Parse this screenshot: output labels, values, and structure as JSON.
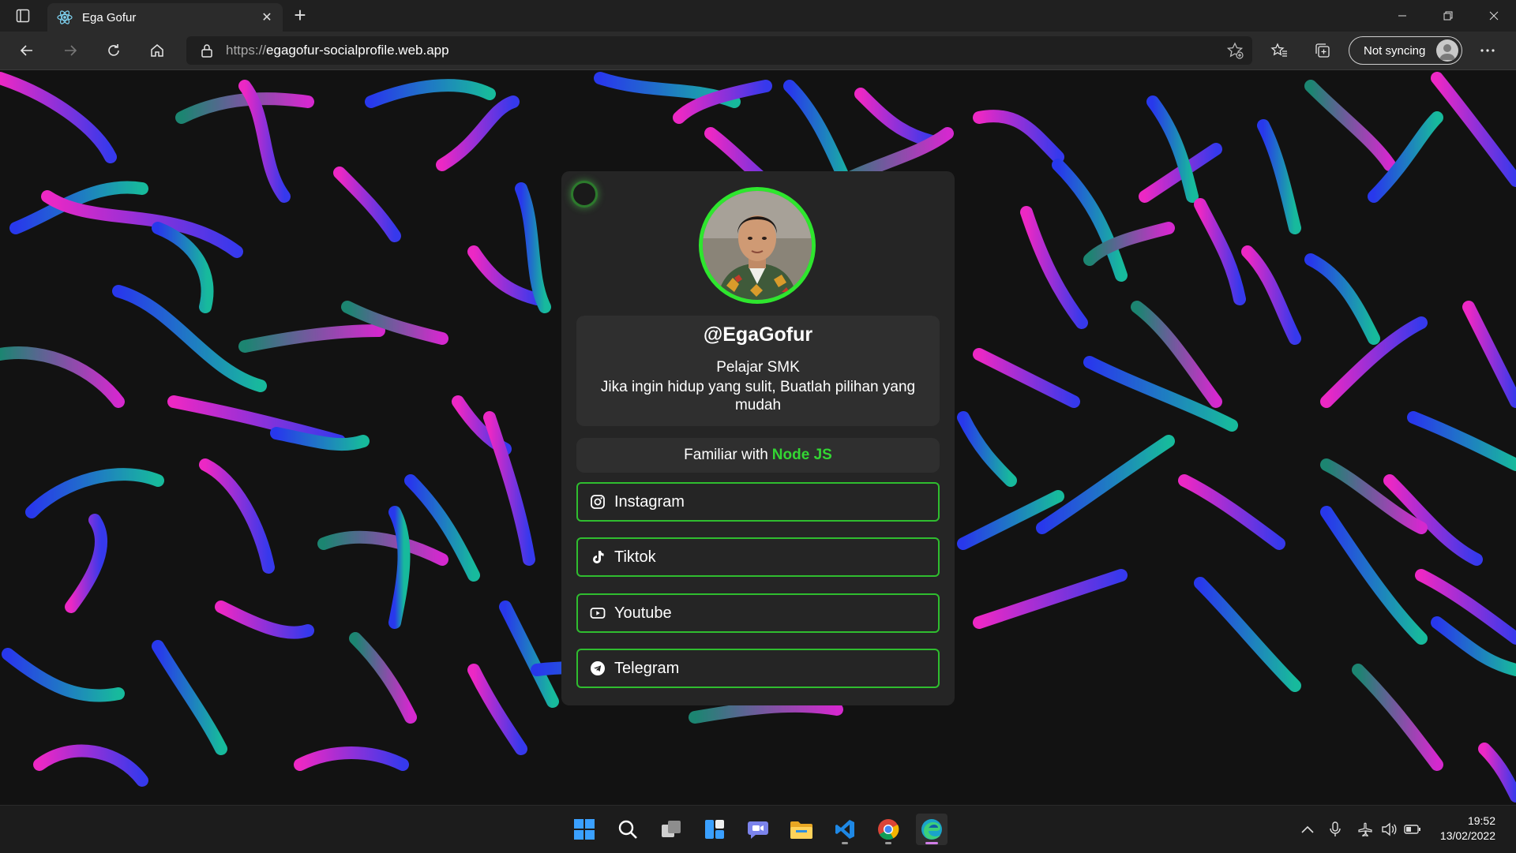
{
  "browser": {
    "tab_title": "Ega Gofur",
    "url_scheme": "https://",
    "url_host": "egagofur-socialprofile.web.app",
    "sync_label": "Not syncing"
  },
  "profile": {
    "username": "@EgaGofur",
    "role": "Pelajar SMK",
    "bio": "Jika ingin hidup yang sulit, Buatlah pilihan yang mudah",
    "familiar_prefix": "Familiar with",
    "familiar_tech": "Node JS",
    "accent_color": "#2ee62e"
  },
  "links": [
    {
      "label": "Instagram",
      "icon": "instagram-icon"
    },
    {
      "label": "Tiktok",
      "icon": "tiktok-icon"
    },
    {
      "label": "Youtube",
      "icon": "youtube-icon"
    },
    {
      "label": "Telegram",
      "icon": "telegram-icon"
    }
  ],
  "taskbar": {
    "time": "19:52",
    "date": "13/02/2022"
  }
}
